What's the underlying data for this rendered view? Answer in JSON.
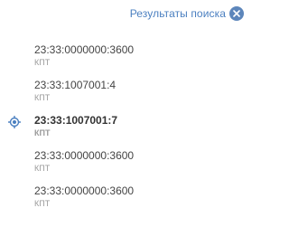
{
  "header": {
    "title": "Результаты поиска",
    "close_icon": "close-icon"
  },
  "results": [
    {
      "number": "23:33:0000000:3600",
      "type": "КПТ",
      "active": false
    },
    {
      "number": "23:33:1007001:4",
      "type": "КПТ",
      "active": false
    },
    {
      "number": "23:33:1007001:7",
      "type": "КПТ",
      "active": true,
      "icon": "locate-icon"
    },
    {
      "number": "23:33:0000000:3600",
      "type": "КПТ",
      "active": false
    },
    {
      "number": "23:33:0000000:3600",
      "type": "КПТ",
      "active": false
    }
  ],
  "colors": {
    "accent": "#4a7fc0",
    "close_bg": "#5d86bb",
    "text": "#444444",
    "muted": "#999999"
  }
}
